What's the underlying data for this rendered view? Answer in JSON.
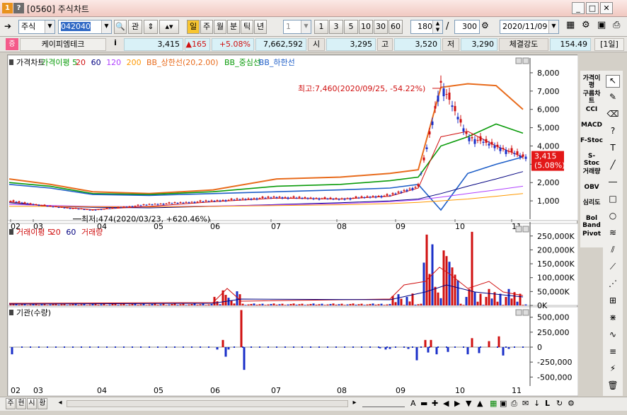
{
  "window": {
    "screen_code": "[0560]",
    "title": "주식차트",
    "badge_num": "1",
    "badge_q": "?",
    "minimize": "_",
    "maximize": "□",
    "close": "✕"
  },
  "toolbar": {
    "market_type": "주식",
    "code": "042040",
    "gwan": "관",
    "periods": [
      "일",
      "주",
      "월",
      "분",
      "틱",
      "년"
    ],
    "interval_select": "1",
    "intervals": [
      "1",
      "3",
      "5",
      "10",
      "30",
      "60"
    ],
    "count": "180",
    "total": "300",
    "slash": "/",
    "date": "2020/11/09"
  },
  "quote": {
    "market_badge": "증",
    "name": "케이피엠테크",
    "info": "i",
    "price": "3,415",
    "change": "▲165",
    "change_pct": "+5.08%",
    "volume": "7,662,592",
    "open_label": "시",
    "open": "3,295",
    "high_label": "고",
    "high": "3,520",
    "low_label": "저",
    "low": "3,290",
    "strength_label": "체결강도",
    "strength": "154.49",
    "period_badge": "[1일]"
  },
  "price_panel": {
    "legend": [
      {
        "text": "가격차트",
        "color": "#000000"
      },
      {
        "text": "가격이평 5",
        "color": "#0a9b0a"
      },
      {
        "text": "20",
        "color": "#d01010"
      },
      {
        "text": "60",
        "color": "#000080"
      },
      {
        "text": "120",
        "color": "#b040ff"
      },
      {
        "text": "200",
        "color": "#ff9900"
      },
      {
        "text": "BB_상한선(20,2.00)",
        "color": "#e86b1c"
      },
      {
        "text": "BB_중심선",
        "color": "#0a9b0a"
      },
      {
        "text": "BB_하한선",
        "color": "#1f5fc8"
      }
    ],
    "high_note": "최고:7,460(2020/09/25, -54.22%)",
    "low_note": "최저:474(2020/03/23, +620.46%)",
    "last_price": "3,415",
    "last_pct": "(5.08%)"
  },
  "volume_panel": {
    "legend": [
      {
        "text": "거래이평 5",
        "color": "#d01010"
      },
      {
        "text": "20",
        "color": "#d01010"
      },
      {
        "text": "60",
        "color": "#000080"
      },
      {
        "text": "거래량",
        "color": "#d01010"
      }
    ]
  },
  "inst_panel": {
    "legend": [
      {
        "text": "기관(수량)",
        "color": "#000000"
      }
    ]
  },
  "chart_data": [
    {
      "type": "candlestick",
      "x_ticks": [
        "02",
        "03",
        "04",
        "05",
        "06",
        "07",
        "08",
        "09",
        "10",
        "11"
      ],
      "y_ticks": [
        "1,000",
        "2,000",
        "3,000",
        "4,000",
        "5,000",
        "6,000",
        "7,000",
        "8,000"
      ],
      "ylim": [
        0,
        8500
      ],
      "series": [
        {
          "name": "BB_상한선",
          "color": "#e86b1c",
          "values": [
            2200,
            1900,
            1500,
            1400,
            1600,
            2200,
            2300,
            2500,
            2700,
            7200,
            7400,
            7300,
            6000
          ]
        },
        {
          "name": "BB_중심선",
          "color": "#0a9b0a",
          "values": [
            2000,
            1800,
            1400,
            1350,
            1500,
            1800,
            1900,
            2100,
            2300,
            4000,
            4500,
            5200,
            4700
          ]
        },
        {
          "name": "BB_하한선",
          "color": "#1f5fc8",
          "values": [
            1900,
            1700,
            1350,
            1300,
            1400,
            1500,
            1600,
            1700,
            1900,
            500,
            2500,
            3000,
            3400
          ]
        },
        {
          "name": "가격",
          "color": "#d01010",
          "values": [
            1000,
            700,
            500,
            800,
            1000,
            1200,
            1100,
            1300,
            1800,
            7460,
            4500,
            4000,
            3415
          ]
        }
      ],
      "high": 7460,
      "low": 474,
      "last": 3415
    },
    {
      "type": "bar",
      "y_ticks": [
        "250,000K",
        "200,000K",
        "150,000K",
        "100,000K",
        "50,000K",
        "0K"
      ],
      "ylim": [
        0,
        280000
      ]
    },
    {
      "type": "bar",
      "y_ticks": [
        "500,000",
        "250,000",
        "0",
        "-250,000",
        "-500,000"
      ],
      "ylim": [
        -650000,
        650000
      ]
    }
  ],
  "right_tools": [
    "가격이평",
    "구름차트",
    "CCI",
    "MACD",
    "F-Stoc",
    "S-Stoc",
    "거래량",
    "OBV",
    "심리도",
    "Bol Band",
    "Pivot"
  ],
  "status": {
    "tabs": [
      "주",
      "현",
      "시",
      "황"
    ],
    "left_arrow": "◂",
    "right_arrow": "▸",
    "text_tool": "A",
    "last_label": "L"
  }
}
